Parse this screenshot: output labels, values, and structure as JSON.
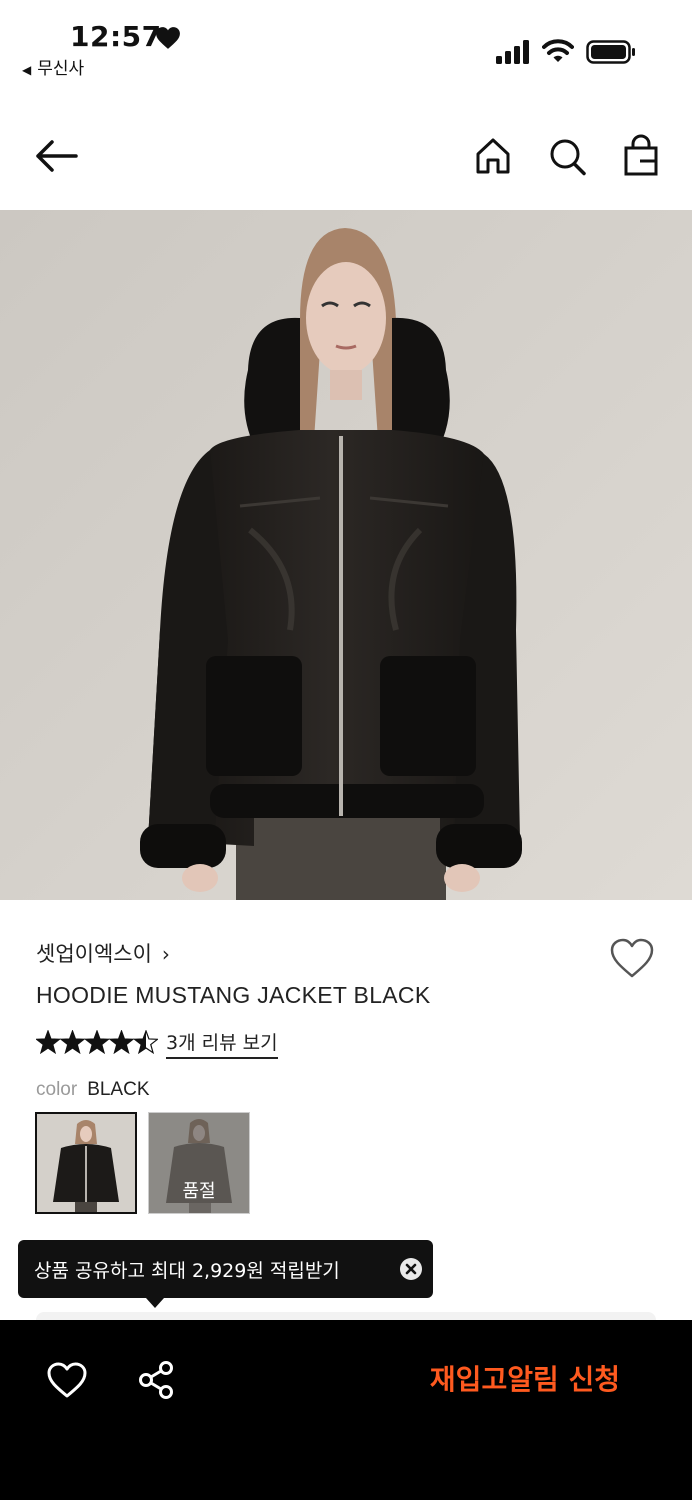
{
  "status_bar": {
    "time": "12:57",
    "back_app_label": "무신사"
  },
  "nav": {
    "back_icon": "arrow-left-icon",
    "home_icon": "home-icon",
    "search_icon": "search-icon",
    "bag_icon": "shopping-bag-icon"
  },
  "product": {
    "brand": "셋업이엑스이",
    "brand_chevron": "›",
    "name": "HOODIE MUSTANG JACKET BLACK",
    "rating": 4.5,
    "review_link": "3개 리뷰 보기",
    "color_label": "color",
    "color_value": "BLACK",
    "swatches": [
      {
        "status": "selected"
      },
      {
        "status": "soldout",
        "label": "품절"
      }
    ]
  },
  "tooltip": {
    "text": "상품 공유하고 최대 2,929원 적립받기"
  },
  "bottom_bar": {
    "restock_label": "재입고알림 신청",
    "accent_color": "#ff5a1f"
  }
}
